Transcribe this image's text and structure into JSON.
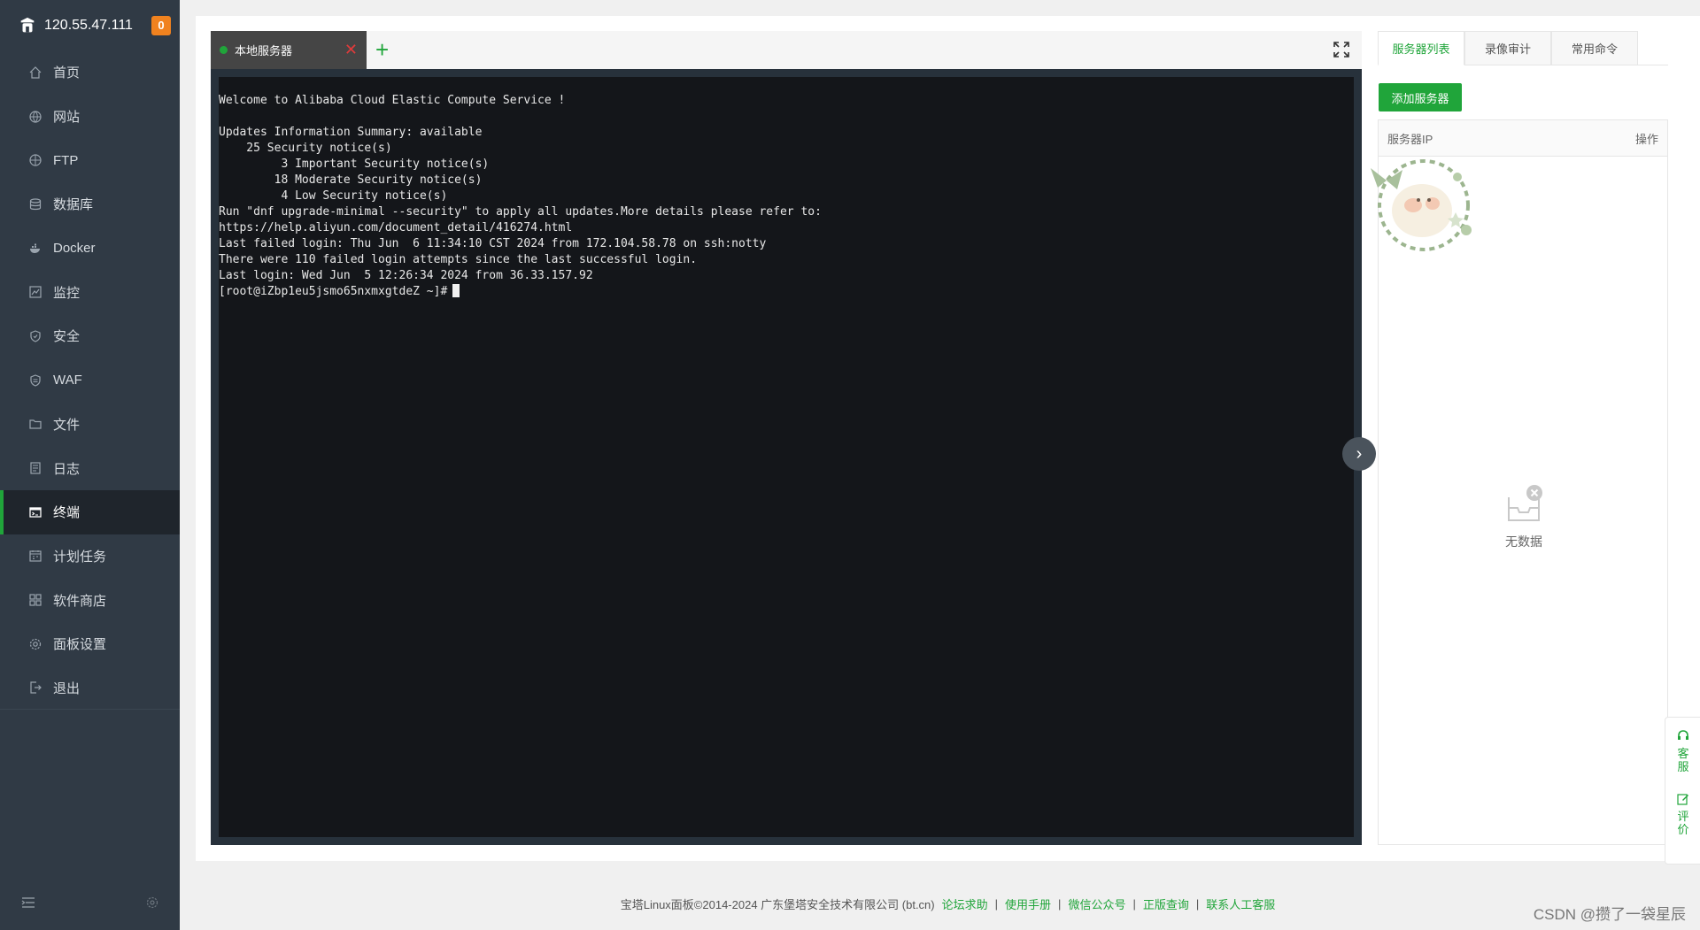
{
  "sidebar": {
    "ip": "120.55.47.111",
    "badge": "0",
    "items": [
      {
        "label": "首页",
        "icon": "home-icon"
      },
      {
        "label": "网站",
        "icon": "globe-icon"
      },
      {
        "label": "FTP",
        "icon": "ftp-icon"
      },
      {
        "label": "数据库",
        "icon": "database-icon"
      },
      {
        "label": "Docker",
        "icon": "docker-icon"
      },
      {
        "label": "监控",
        "icon": "monitor-icon"
      },
      {
        "label": "安全",
        "icon": "shield-icon"
      },
      {
        "label": "WAF",
        "icon": "waf-shield-icon"
      },
      {
        "label": "文件",
        "icon": "folder-icon"
      },
      {
        "label": "日志",
        "icon": "log-icon"
      },
      {
        "label": "终端",
        "icon": "terminal-icon",
        "active": true
      },
      {
        "label": "计划任务",
        "icon": "calendar-icon"
      },
      {
        "label": "软件商店",
        "icon": "apps-icon"
      },
      {
        "label": "面板设置",
        "icon": "gear-icon"
      },
      {
        "label": "退出",
        "icon": "logout-icon"
      }
    ]
  },
  "terminal": {
    "tab_label": "本地服务器",
    "lines": [
      "Welcome to Alibaba Cloud Elastic Compute Service !",
      "",
      "Updates Information Summary: available",
      "    25 Security notice(s)",
      "         3 Important Security notice(s)",
      "        18 Moderate Security notice(s)",
      "         4 Low Security notice(s)",
      "Run \"dnf upgrade-minimal --security\" to apply all updates.More details please refer to:",
      "https://help.aliyun.com/document_detail/416274.html",
      "Last failed login: Thu Jun  6 11:34:10 CST 2024 from 172.104.58.78 on ssh:notty",
      "There were 110 failed login attempts since the last successful login.",
      "Last login: Wed Jun  5 12:26:34 2024 from 36.33.157.92"
    ],
    "prompt": "[root@iZbp1eu5jsmo65nxmxgtdeZ ~]#"
  },
  "right_panel": {
    "tabs": [
      "服务器列表",
      "录像审计",
      "常用命令"
    ],
    "add_button": "添加服务器",
    "col_ip": "服务器IP",
    "col_action": "操作",
    "empty_text": "无数据"
  },
  "float_widget": {
    "service": "客服",
    "review": "评价"
  },
  "footer": {
    "copyright": "宝塔Linux面板©2014-2024 广东堡塔安全技术有限公司 (bt.cn)",
    "links": [
      "论坛求助",
      "使用手册",
      "微信公众号",
      "正版查询",
      "联系人工客服"
    ],
    "separator": "|"
  },
  "watermark": "CSDN @攒了一袋星辰",
  "colors": {
    "accent": "#20a53a",
    "sidebar_bg": "#303a45",
    "terminal_bg": "#14161a",
    "badge": "#f0821f"
  }
}
